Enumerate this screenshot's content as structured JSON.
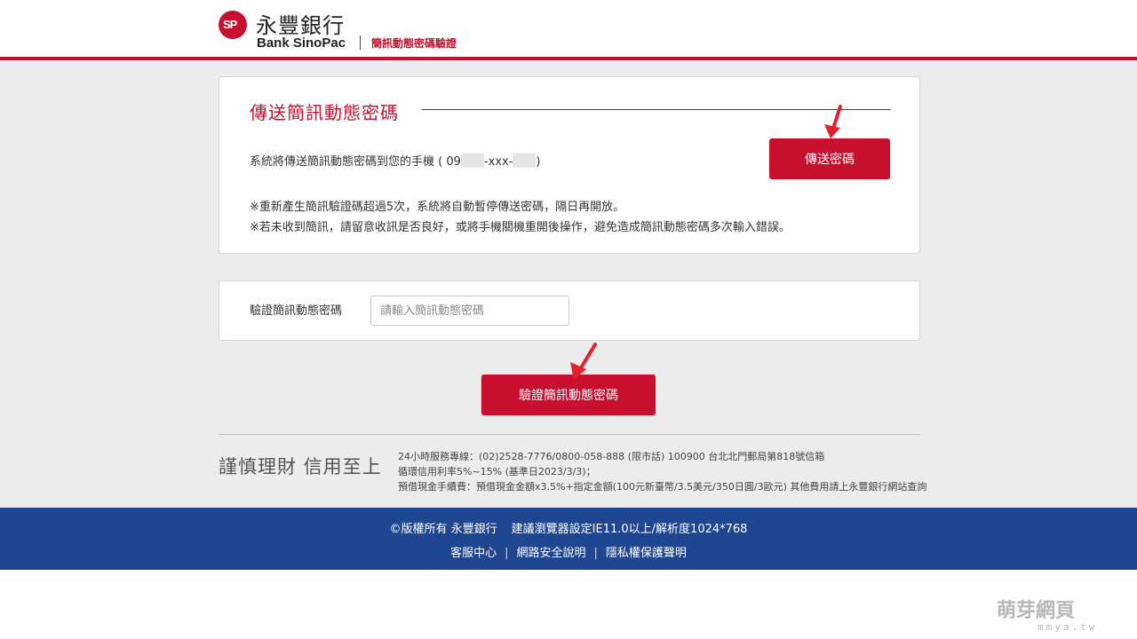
{
  "header": {
    "logo_mark": "SP",
    "bank_name_zh": "永豐銀行",
    "bank_name_en": "Bank SinoPac",
    "page_subtitle": "簡訊動態密碼驗證"
  },
  "send_card": {
    "title": "傳送簡訊動態密碼",
    "desc_prefix": "系統將傳送簡訊動態密碼到您的手機 ( 09",
    "desc_middle": "-xxx-",
    "desc_suffix": ")",
    "send_button": "傳送密碼",
    "note1": "※重新產生簡訊驗證碼超過5次，系統將自動暫停傳送密碼，隔日再開放。",
    "note2": "※若未收到簡訊，請留意收訊是否良好，或將手機關機重開後操作，避免造成簡訊動態密碼多次輸入錯誤。"
  },
  "verify_card": {
    "label": "驗證簡訊動態密碼",
    "input_placeholder": "請輸入簡訊動態密碼",
    "input_value": ""
  },
  "verify_button": "驗證簡訊動態密碼",
  "info": {
    "slogan": "謹慎理財 信用至上",
    "line1": "24小時服務專線：(02)2528-7776/0800-058-888 (限市話) 100900 台北北門郵局第818號信箱",
    "line2": "循環信用利率5%~15% (基準日2023/3/3)；",
    "line3": "預借現金手續費：預借現金金額x3.5%+指定金額(100元新臺幣/3.5美元/350日圓/3歐元) 其他費用請上永豐銀行網站查詢"
  },
  "footer": {
    "copyright": "©版權所有 永豐銀行",
    "browser_note": "建議瀏覽器設定IE11.0以上/解析度1024*768",
    "links": [
      "客服中心",
      "網路安全說明",
      "隱私權保護聲明"
    ]
  },
  "watermark": {
    "text": "萌芽網頁",
    "sub": "mmya.tw"
  },
  "colors": {
    "brand_red": "#c8102e",
    "footer_blue": "#1f4690",
    "background_gray": "#ececec"
  }
}
